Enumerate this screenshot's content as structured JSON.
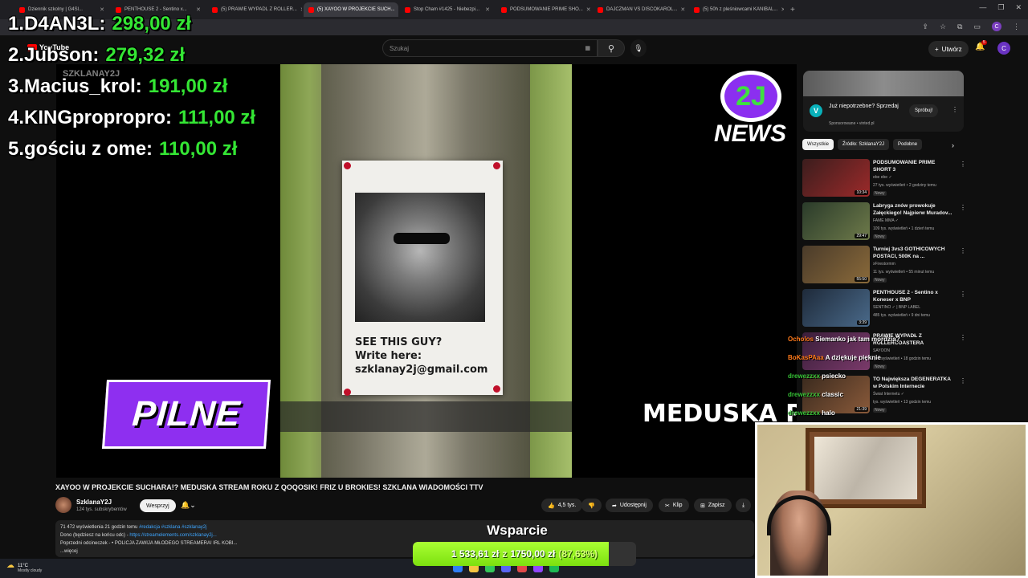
{
  "browser": {
    "tabs": [
      {
        "label": "Dziennik szkolny | G4Sl..."
      },
      {
        "label": "PENTHOUSE 2 - Sentino x..."
      },
      {
        "label": "(5) PRAWIE WYPADL Z ROLLER..."
      },
      {
        "label": "(5) XAYOO W PROJEKCIE SUCH...",
        "active": true
      },
      {
        "label": "Stop Cham #1425 - Niebezpi..."
      },
      {
        "label": "PODSUMOWANIE PRIME SHO..."
      },
      {
        "label": "DAJCZMAN VS DISCOKAROL..."
      },
      {
        "label": "(5) 50h z pleśniowcami KANIBAL..."
      }
    ],
    "new_tab": "+"
  },
  "youtube": {
    "logo_text": "YouTube",
    "search_placeholder": "Szukaj",
    "create_label": "Utwórz",
    "notifications": "5",
    "avatar_letter": "C"
  },
  "leaderboard": [
    {
      "rank": "1.",
      "name": "D4AN3L:",
      "amount": "298,00 zł"
    },
    {
      "rank": "2.",
      "name": "Jubson:",
      "amount": "279,32 zł"
    },
    {
      "rank": "3.",
      "name": "Macius_krol:",
      "amount": "191,00 zł"
    },
    {
      "rank": "4.",
      "name": "KINGpropropro:",
      "amount": "111,00 zł"
    },
    {
      "rank": "5.",
      "name": "gościu z ome:",
      "amount": "110,00 zł"
    }
  ],
  "video": {
    "watermark": "SZKLANAY2J",
    "poster_line1": "SEE THIS GUY?",
    "poster_line2": "Write here:",
    "poster_line3": "szklanay2j@gmail.com",
    "pilne": "PILNE",
    "news_mark": "2J",
    "news_text": "NEWS",
    "ticker": "MEDUSKA POD"
  },
  "meta": {
    "title": "XAYOO W PROJEKCIE SUCHARA!? MEDUSKA STREAM ROKU Z QOQOSIK! FRIZ U BROKIES! SZKLANA WIADOMOŚCI TTV",
    "channel": "SzklanaY2J",
    "subscribers": "124 tys. subskrybentów",
    "join": "Wesprzyj",
    "likes": "4,5 tys.",
    "share": "Udostępnij",
    "clip": "Klip",
    "save": "Zapisz",
    "desc_stats": "71 472 wyświetlenia  21 godzin temu",
    "desc_tags": "#redakcja #szklana #szklanay2j",
    "desc_line2_prefix": "Dono (będziesz na końcu odc) - ",
    "desc_line2_link": "https://streamelements.com/szklanay2j...",
    "desc_line3_prefix": "Poprzedni odcineczek - ",
    "desc_line3_link": "• POLICJA ZAWIJA MŁODEGO STREAMERA! IRL KOBI...",
    "desc_more": "...więcej"
  },
  "ad": {
    "title": "Już niepotrzebne? Sprzedaj",
    "sponsored": "Sponsorowane • vinted.pl",
    "cta": "Spróbuj!",
    "logo": "V"
  },
  "chips": [
    "Wszystkie",
    "Źródło: SzklanaY2J",
    "Podobne"
  ],
  "recommendations": [
    {
      "title": "PODSUMOWANIE PRIME SHORT 3",
      "channel": "ebe ebe ✓",
      "meta": "27 tys. wyświetleń • 2 godziny temu",
      "badge": "Nowy",
      "duration": "10:34",
      "colors": [
        "#3b1d1d",
        "#9c2a2a"
      ]
    },
    {
      "title": "Labryga znów prowokuje Załęckiego! Najpierw Muradov...",
      "channel": "FAME MMA ✓",
      "meta": "109 tys. wyświetleń • 1 dzień temu",
      "badge": "Nowy",
      "duration": "29:47",
      "colors": [
        "#2a3b2a",
        "#6e7a4a"
      ]
    },
    {
      "title": "Turniej 3vs3 GOTHICOWYCH POSTACI, 500K na ...",
      "channel": "xFirestormm",
      "meta": "11 tys. wyświetleń • 55 minut temu",
      "badge": "Nowy",
      "duration": "55:50",
      "colors": [
        "#4a3b2a",
        "#8a6a3a"
      ]
    },
    {
      "title": "PENTHOUSE 2 - Sentino x Koneser x BNP",
      "channel": "SENTINO ✓ | BNP LABEL",
      "meta": "485 tys. wyświetleń • 9 dni temu",
      "badge": "",
      "duration": "3:39",
      "colors": [
        "#1e2a3a",
        "#4a6a8a"
      ]
    },
    {
      "title": "PRAWIE WYPADŁ Z ROLLERCOASTERA",
      "channel": "SAYOON",
      "meta": "tys. wyświetleń • 18 godzin temu",
      "badge": "Nowy",
      "duration": "",
      "colors": [
        "#3a1e3a",
        "#7a3a6a"
      ]
    },
    {
      "title": "TO Największa DEGENERATKA w Polskim Internecie",
      "channel": "Świat Internetu ✓",
      "meta": "tys. wyświetleń • 13 godzin temu",
      "badge": "Nowy",
      "duration": "21:39",
      "colors": [
        "#3a2a1e",
        "#8a5a3a"
      ]
    }
  ],
  "chat": [
    {
      "user": "Ocholos",
      "msg": "Siemanko jak tam mordzia?",
      "color": "orange"
    },
    {
      "user": "BoKasPAaa",
      "msg": "A dziękuje pięknie",
      "color": "orange"
    },
    {
      "user": "drewezzxx",
      "msg": "psiecko",
      "color": "green"
    },
    {
      "user": "drewezzxx",
      "msg": "classic",
      "color": "green"
    },
    {
      "user": "drewezzxx",
      "msg": "halo",
      "color": "green"
    }
  ],
  "donation": {
    "title": "Wsparcie",
    "current": "1 533,61 zł",
    "separator": "z",
    "goal": "1750,00 zł",
    "percent_label": "(87,63%)",
    "fraction": 0.8763
  },
  "taskbar": {
    "temp": "11°C",
    "weather": "Mostly cloudy"
  }
}
